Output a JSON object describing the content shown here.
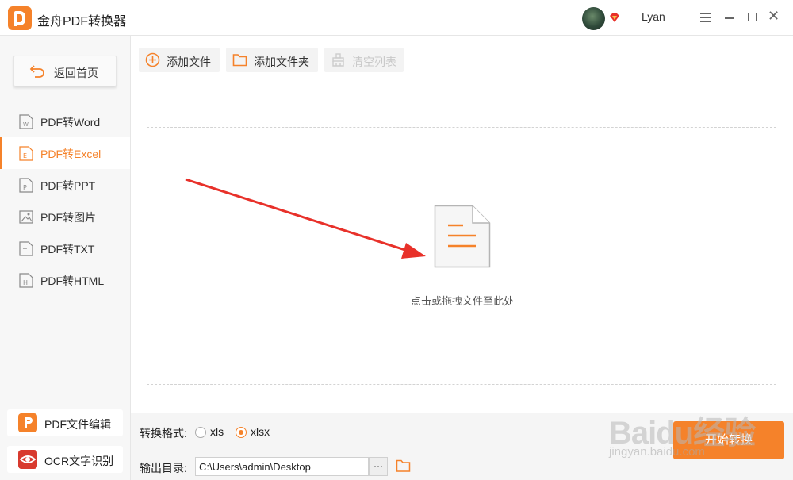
{
  "app": {
    "title": "金舟PDF转换器"
  },
  "user": {
    "name": "Lyan"
  },
  "sidebar": {
    "back_label": "返回首页",
    "items": [
      {
        "label": "PDF转Word",
        "active": false
      },
      {
        "label": "PDF转Excel",
        "active": true
      },
      {
        "label": "PDF转PPT",
        "active": false
      },
      {
        "label": "PDF转图片",
        "active": false
      },
      {
        "label": "PDF转TXT",
        "active": false
      },
      {
        "label": "PDF转HTML",
        "active": false
      }
    ],
    "tools": [
      {
        "label": "PDF文件编辑"
      },
      {
        "label": "OCR文字识别"
      }
    ]
  },
  "toolbar": {
    "add_file": "添加文件",
    "add_folder": "添加文件夹",
    "clear_list": "清空列表"
  },
  "drop_zone": {
    "hint": "点击或拖拽文件至此处"
  },
  "bottom": {
    "format_label": "转换格式:",
    "format_options": [
      "xls",
      "xlsx"
    ],
    "selected_format": "xlsx",
    "output_label": "输出目录:",
    "output_path": "C:\\Users\\admin\\Desktop",
    "browse_label": "···",
    "start_label": "开始转换"
  },
  "watermark": {
    "text": "Baidu经验",
    "sub": "jingyan.baidu.com"
  },
  "colors": {
    "accent": "#f5822a",
    "arrow": "#e8312a"
  }
}
